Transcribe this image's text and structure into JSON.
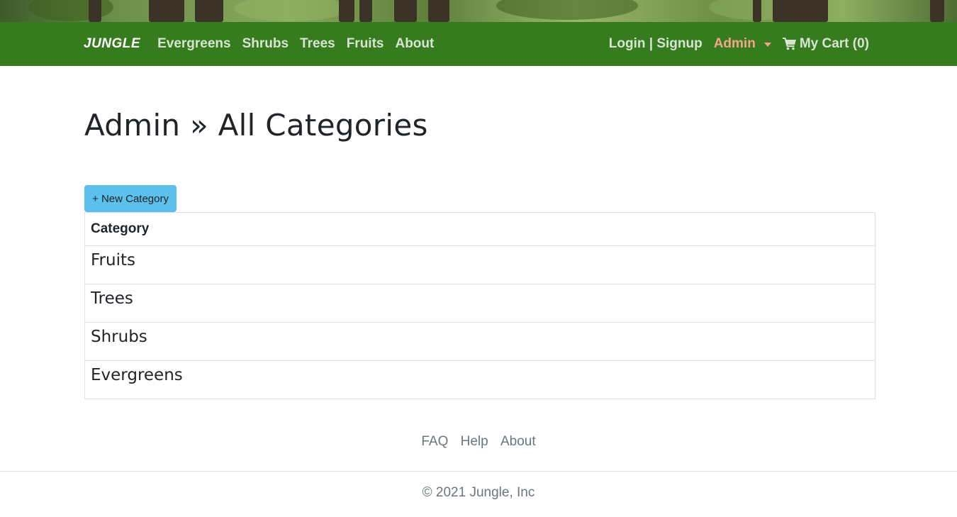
{
  "colors": {
    "nav_bg": "#367c1e",
    "admin_accent": "#f2a48c",
    "button_bg": "#5bc0eb"
  },
  "navbar": {
    "brand": "JUNGLE",
    "links": [
      "Evergreens",
      "Shrubs",
      "Trees",
      "Fruits",
      "About"
    ],
    "auth": "Login | Signup",
    "admin": "Admin",
    "cart": "My Cart (0)"
  },
  "main": {
    "title": "Admin » All Categories",
    "new_button": "+ New Category",
    "table": {
      "header": "Category",
      "rows": [
        "Fruits",
        "Trees",
        "Shrubs",
        "Evergreens"
      ]
    }
  },
  "footer": {
    "links": [
      "FAQ",
      "Help",
      "About"
    ],
    "copyright": "© 2021 Jungle, Inc"
  },
  "icons": {
    "cart": "shopping-cart-icon",
    "admin_dropdown": "caret-down-icon"
  }
}
